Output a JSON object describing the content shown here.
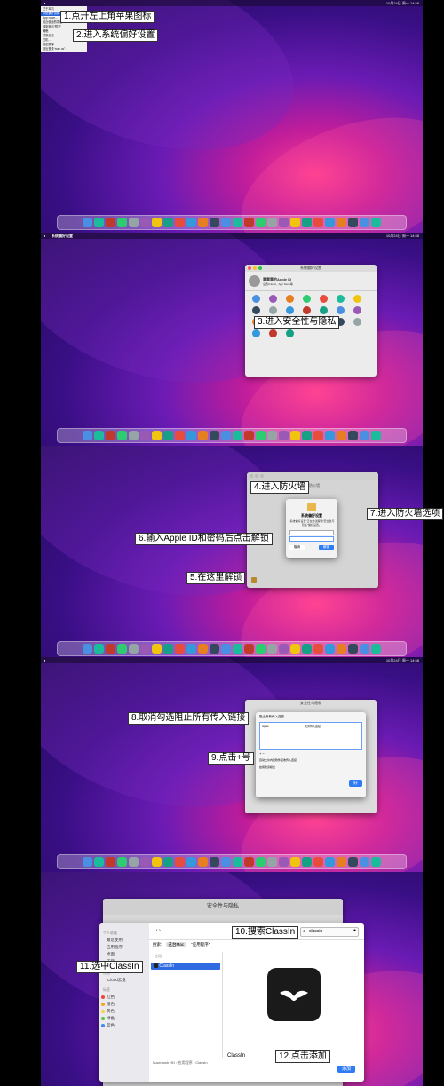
{
  "steps": {
    "s1": "1.点开左上角苹果图标",
    "s2": "2.进入系统偏好设置",
    "s3": "3.进入安全性与隐私",
    "s4": "4.进入防火墙",
    "s5": "5.在这里解锁",
    "s6": "6.输入Apple ID和密码后点击解锁",
    "s7": "7.进入防火墙选项",
    "s8": "8.取消勾选阻止所有传入链接",
    "s9": "9.点击+号",
    "s10": "10.搜索ClassIn",
    "s11": "11.选中ClassIn",
    "s12": "12.点击添加"
  },
  "panel1": {
    "menu_items": [
      "关于本机",
      "系统偏好设置…",
      "App Store…",
      "最近使用的项目",
      "强制退出“预览”",
      "睡眠",
      "重新启动…",
      "关机…",
      "锁定屏幕",
      "退出登录“mac os”…"
    ]
  },
  "panel2": {
    "window_title": "系统偏好设置",
    "user_name": "塞塞塞的Apple ID",
    "user_sub": "设置iCloud、App Store等"
  },
  "panel3": {
    "dialog_title": "系统偏好设置",
    "dialog_text": "“系统偏好设置”正在尝试解锁“安全性与隐私”偏好设置。",
    "cancel": "取消",
    "unlock": "解锁",
    "firewall_tab": "防火墙"
  },
  "panel4": {
    "window_title": "安全性与隐私",
    "block_all": "阻止所有传入连接",
    "row_app": "Apple",
    "row_status": "允许传入连接",
    "auto_signed": "自动允许内建软件接收传入连接",
    "stealth": "启用隐身模式",
    "ok": "好"
  },
  "panel5": {
    "window_title": "安全性与隐私",
    "sidebar_fav": "个人收藏",
    "sidebar_items": [
      "最近使用",
      "应用程序",
      "桌面",
      "下载"
    ],
    "sidebar_loc": "位置",
    "sidebar_icloud": "iCloud云盘",
    "sidebar_tags": "标签",
    "tags": [
      "红色",
      "橙色",
      "黄色",
      "绿色",
      "蓝色"
    ],
    "search_label": "搜索:",
    "scope_mac": "这台Mac",
    "scope_apps": "“应用程序”",
    "section": "应用",
    "result": "ClassIn",
    "search_value": "classin",
    "preview_name": "ClassIn",
    "path": "Macintosh HD › 应用程序 › ClassIn",
    "add": "添加"
  },
  "status_bar": {
    "clock": "10月24日 周一 14:58"
  },
  "colors": {
    "accent": "#2f7bf6",
    "callout_bg": "#ffffff"
  }
}
